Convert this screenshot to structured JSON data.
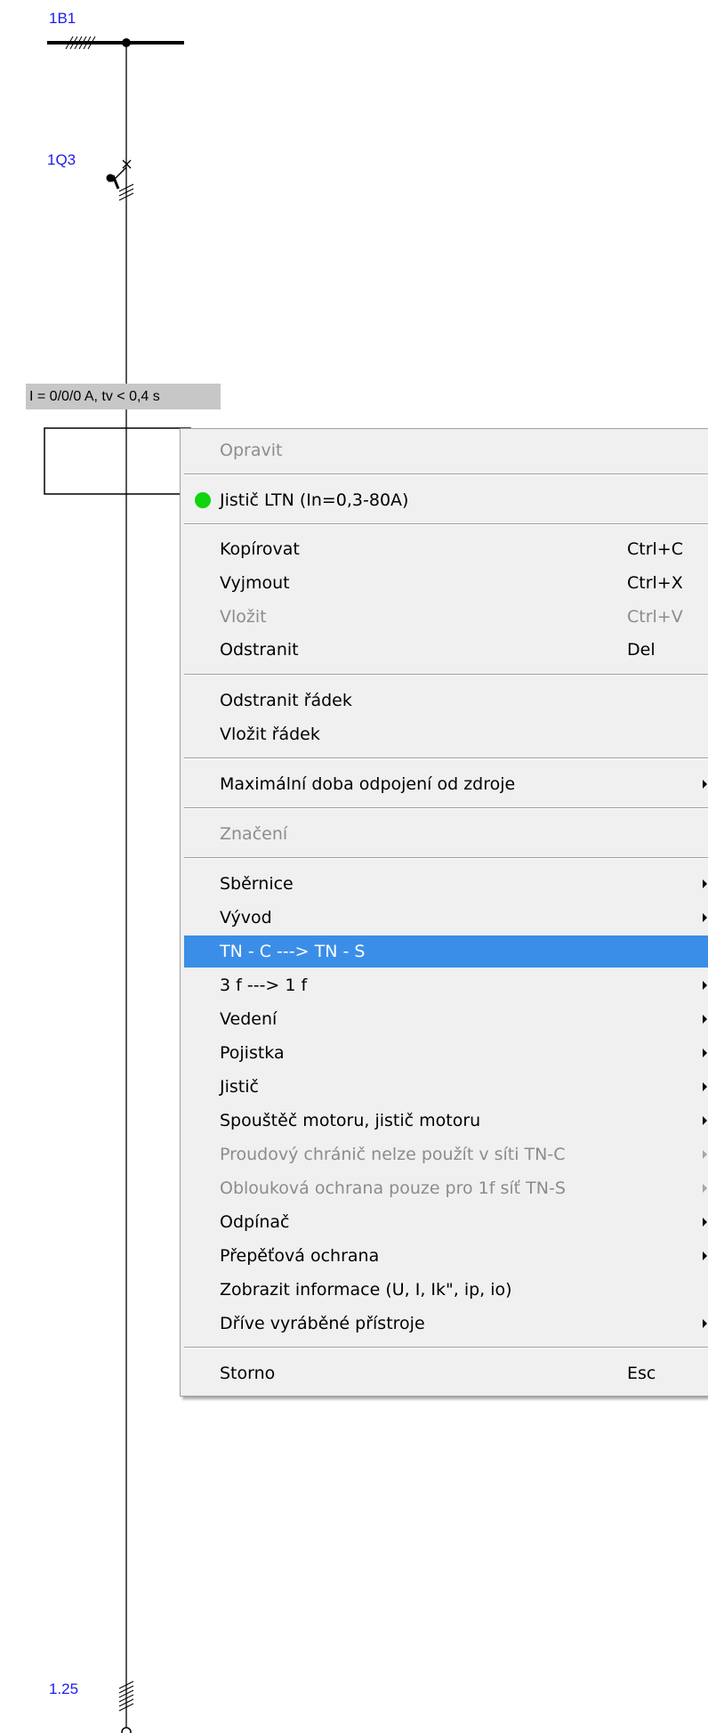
{
  "diagram": {
    "labels": {
      "busbar": "1B1",
      "breaker": "1Q3",
      "node": "1.25"
    },
    "status": "I = 0/0/0 A, tv < 0,4 s"
  },
  "menu": {
    "items": [
      {
        "label": "Opravit",
        "disabled": true
      },
      {
        "label": "Jistič LTN (In=0,3-80A)",
        "icon": "green-dot"
      },
      {
        "label": "Kopírovat",
        "shortcut": "Ctrl+C"
      },
      {
        "label": "Vyjmout",
        "shortcut": "Ctrl+X"
      },
      {
        "label": "Vložit",
        "shortcut": "Ctrl+V",
        "disabled": true
      },
      {
        "label": "Odstranit",
        "shortcut": "Del"
      },
      {
        "label": "Odstranit řádek"
      },
      {
        "label": "Vložit řádek"
      },
      {
        "label": "Maximální doba odpojení od zdroje",
        "submenu": true
      },
      {
        "label": "Značení",
        "disabled": true
      },
      {
        "label": "Sběrnice",
        "submenu": true
      },
      {
        "label": "Vývod",
        "submenu": true
      },
      {
        "label": "TN - C  ---> TN - S",
        "highlighted": true
      },
      {
        "label": "3 f  --->  1 f",
        "submenu": true
      },
      {
        "label": "Vedení",
        "submenu": true
      },
      {
        "label": "Pojistka",
        "submenu": true
      },
      {
        "label": "Jistič",
        "submenu": true
      },
      {
        "label": "Spouštěč motoru, jistič motoru",
        "submenu": true
      },
      {
        "label": "Proudový chránič nelze použít v síti TN-C",
        "submenu": true,
        "disabled": true
      },
      {
        "label": "Oblouková ochrana pouze pro 1f síť TN-S",
        "submenu": true,
        "disabled": true
      },
      {
        "label": "Odpínač",
        "submenu": true
      },
      {
        "label": "Přepěťová ochrana",
        "submenu": true
      },
      {
        "label": "Zobrazit informace (U, I, Ik\", ip, io)"
      },
      {
        "label": "Dříve vyráběné přístroje",
        "submenu": true
      },
      {
        "label": "Storno",
        "shortcut": "Esc"
      }
    ]
  },
  "colors": {
    "label_blue": "#1c1cf0",
    "highlight": "#3b8ee8",
    "menu_bg": "#f0f0f0",
    "status_bg": "#c7c7c7",
    "green_dot": "#10d40e"
  }
}
